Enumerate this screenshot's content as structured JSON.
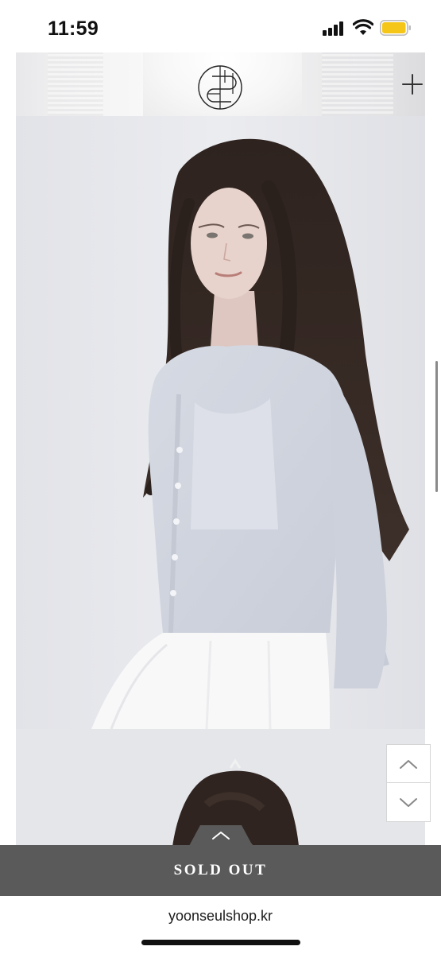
{
  "status_bar": {
    "time": "11:59",
    "icons": [
      "signal-icon",
      "wifi-icon",
      "battery-icon"
    ],
    "battery_color": "#f5c518"
  },
  "header": {
    "logo_icon": "brand-monogram-logo",
    "menu_icon": "plus-icon"
  },
  "page_nav": {
    "up_icon": "chevron-up-icon",
    "down_icon": "chevron-down-icon"
  },
  "purchase": {
    "status_label": "SOLD OUT",
    "expand_icon": "chevron-up-icon",
    "bar_color": "#5a5a5a"
  },
  "browser": {
    "url": "yoonseulshop.kr"
  }
}
